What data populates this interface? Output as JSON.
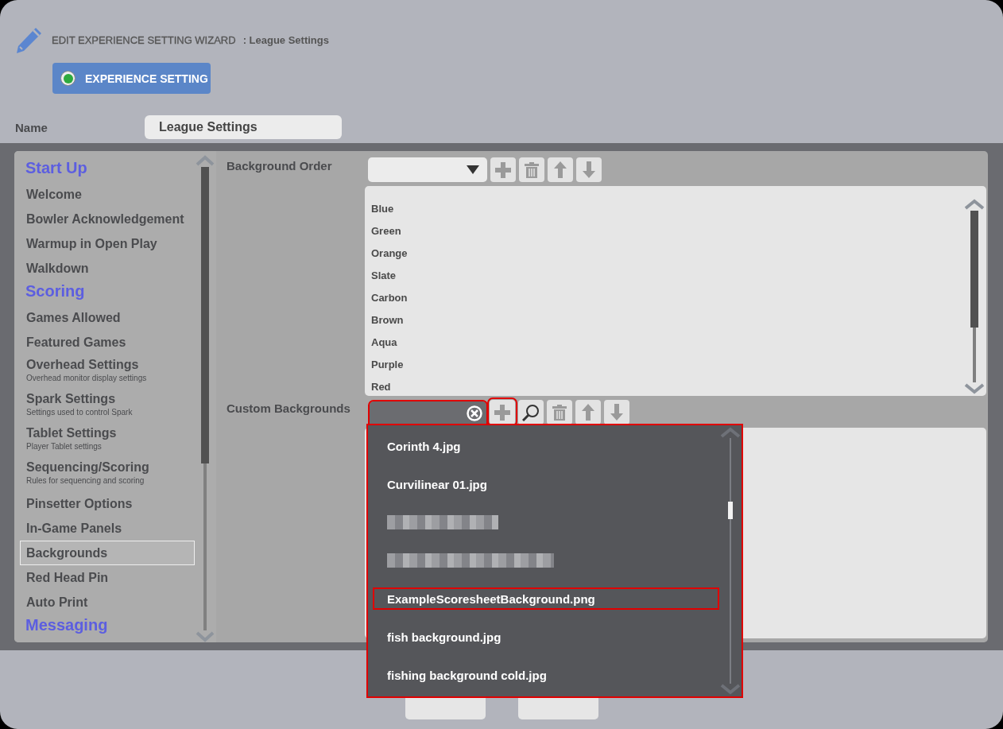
{
  "header": {
    "title": "EDIT EXPERIENCE SETTING WIZARD",
    "subtitle": ": League Settings"
  },
  "steps": [
    {
      "label": "EXPERIENCE SETTING",
      "selected": true
    }
  ],
  "name_field": {
    "label": "Name",
    "value": "League Settings"
  },
  "sidebar": {
    "items": [
      {
        "kind": "heading",
        "label": "Start Up"
      },
      {
        "kind": "item",
        "label": "Welcome",
        "selected": false
      },
      {
        "kind": "item",
        "label": "Bowler Acknowledgement",
        "selected": false
      },
      {
        "kind": "item",
        "label": "Warmup in Open Play",
        "selected": false
      },
      {
        "kind": "item",
        "label": "Walkdown",
        "selected": false
      },
      {
        "kind": "heading",
        "label": "Scoring"
      },
      {
        "kind": "item",
        "label": "Games Allowed",
        "selected": false
      },
      {
        "kind": "item",
        "label": "Featured Games",
        "selected": false
      },
      {
        "kind": "item",
        "label": "Overhead Settings",
        "description": "Overhead monitor display settings",
        "selected": false
      },
      {
        "kind": "item",
        "label": "Spark Settings",
        "description": "Settings used to control Spark",
        "selected": false
      },
      {
        "kind": "item",
        "label": "Tablet Settings",
        "description": "Player Tablet settings",
        "selected": false
      },
      {
        "kind": "item",
        "label": "Sequencing/Scoring",
        "description": "Rules for sequencing and scoring",
        "selected": false
      },
      {
        "kind": "item",
        "label": "Pinsetter Options",
        "selected": false
      },
      {
        "kind": "item",
        "label": "In-Game Panels",
        "selected": false
      },
      {
        "kind": "item",
        "label": "Backgrounds",
        "selected": true
      },
      {
        "kind": "item",
        "label": "Red Head Pin",
        "selected": false
      },
      {
        "kind": "item",
        "label": "Auto Print",
        "selected": false
      },
      {
        "kind": "heading",
        "label": "Messaging"
      }
    ]
  },
  "background_order": {
    "label": "Background Order",
    "toolbar": [
      {
        "kind": "add",
        "highlighted": false
      },
      {
        "kind": "delete",
        "highlighted": false
      },
      {
        "kind": "up",
        "highlighted": false
      },
      {
        "kind": "down",
        "highlighted": false
      }
    ],
    "items": [
      "Blue",
      "Green",
      "Orange",
      "Slate",
      "Carbon",
      "Brown",
      "Aqua",
      "Purple",
      "Red"
    ]
  },
  "custom_backgrounds": {
    "label": "Custom Backgrounds",
    "field": {
      "highlighted": true
    },
    "toolbar": [
      {
        "kind": "add",
        "highlighted": true
      },
      {
        "kind": "search",
        "highlighted": false
      },
      {
        "kind": "delete",
        "highlighted": false
      },
      {
        "kind": "up",
        "highlighted": false
      },
      {
        "kind": "down",
        "highlighted": false
      }
    ],
    "dropdown": {
      "highlighted": true,
      "items": [
        {
          "kind": "file",
          "label": "Corinth 4.jpg",
          "highlighted": false
        },
        {
          "kind": "file",
          "label": "Curvilinear 01.jpg",
          "highlighted": false
        },
        {
          "kind": "redacted"
        },
        {
          "kind": "redacted"
        },
        {
          "kind": "file",
          "label": "ExampleScoresheetBackground.png",
          "highlighted": true
        },
        {
          "kind": "file",
          "label": "fish background.jpg",
          "highlighted": false
        },
        {
          "kind": "file",
          "label": "fishing background cold.jpg",
          "highlighted": false
        }
      ]
    }
  }
}
